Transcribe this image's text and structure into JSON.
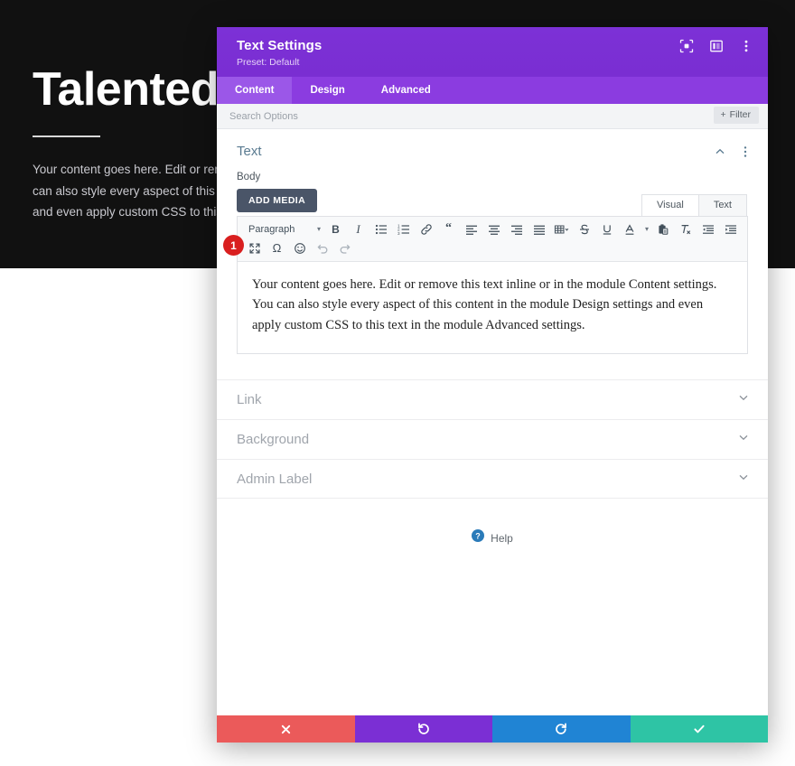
{
  "background": {
    "hero_title": "Talented people",
    "hero_body": "Your content goes here. Edit or remove this text inline or in the module Content settings. You can also style every aspect of this content in the module Design settings\nand even apply custom CSS to this text in the module Advanced settings.",
    "hero_bg_color": "#111111"
  },
  "modal": {
    "title": "Text Settings",
    "preset": "Preset: Default",
    "header_color": "#7b2fd4",
    "icons": {
      "focus": "focus-icon",
      "layout": "layout-columns-icon",
      "more": "more-vertical-icon"
    },
    "tabs": [
      {
        "label": "Content",
        "active": true
      },
      {
        "label": "Design",
        "active": false
      },
      {
        "label": "Advanced",
        "active": false
      }
    ],
    "search": {
      "placeholder": "Search Options",
      "value": "",
      "filter_label": "Filter",
      "filter_icon": "plus-icon"
    },
    "section": {
      "title": "Text",
      "collapse_icon": "chevron-up-icon",
      "more_icon": "more-vertical-icon"
    },
    "body_field": {
      "label": "Body",
      "add_media_label": "ADD MEDIA"
    },
    "editor": {
      "mode_tabs": [
        {
          "label": "Visual",
          "active": true
        },
        {
          "label": "Text",
          "active": false
        }
      ],
      "format_select": "Paragraph",
      "toolbar_row1": [
        "bold-icon",
        "italic-icon",
        "bulleted-list-icon",
        "numbered-list-icon",
        "link-icon",
        "blockquote-icon",
        "align-left-icon",
        "align-center-icon",
        "align-right-icon",
        "align-justify-icon",
        "table-icon",
        "strikethrough-icon",
        "underline-icon",
        "text-color-icon",
        "paste-as-text-icon",
        "clear-formatting-icon",
        "outdent-icon",
        "indent-icon"
      ],
      "toolbar_row2": [
        "fullscreen-icon",
        "special-character-icon",
        "emoji-icon",
        "undo-icon",
        "redo-icon"
      ],
      "content": "Your content goes here. Edit or remove this text inline or in the module Content settings. You can also style every aspect of this content in the module Design settings and even apply custom CSS to this text in the module Advanced settings."
    },
    "marker_badge": "1",
    "accordion": [
      {
        "label": "Link",
        "icon": "chevron-down-icon"
      },
      {
        "label": "Background",
        "icon": "chevron-down-icon"
      },
      {
        "label": "Admin Label",
        "icon": "chevron-down-icon"
      }
    ],
    "help": {
      "label": "Help",
      "icon": "question-circle-icon"
    },
    "footer_buttons": [
      {
        "name": "cancel",
        "icon": "close-icon",
        "color": "#eb5a5a"
      },
      {
        "name": "reset",
        "icon": "undo-icon",
        "color": "#7b2fd4"
      },
      {
        "name": "redo",
        "icon": "redo-icon",
        "color": "#2084d4"
      },
      {
        "name": "save",
        "icon": "check-icon",
        "color": "#2ec4a5"
      }
    ]
  }
}
